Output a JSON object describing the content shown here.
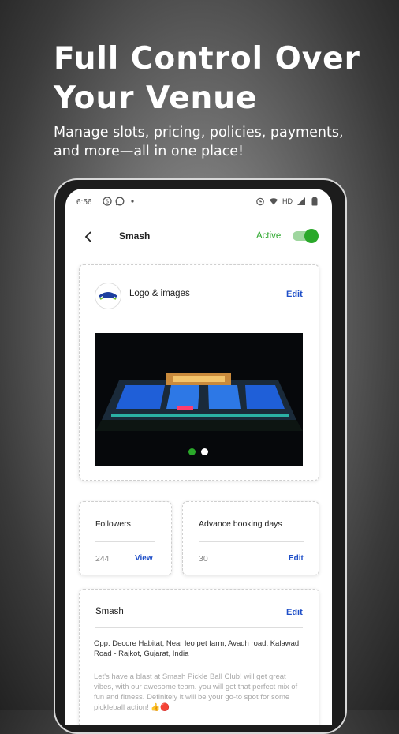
{
  "promo": {
    "headline_line1": "Full Control Over",
    "headline_line2": "Your Venue",
    "subline_line1": "Manage slots, pricing, policies, payments,",
    "subline_line2": "and more—all in one place!"
  },
  "statusbar": {
    "time": "6:56",
    "left_icons": [
      "skype-icon",
      "whatsapp-icon",
      "dot-icon"
    ],
    "right_text": "HD",
    "right_icons": [
      "alarm-icon",
      "wifi-icon",
      "signal-icon",
      "battery-icon"
    ]
  },
  "appbar": {
    "title": "Smash",
    "active_label": "Active",
    "active_toggle_on": true
  },
  "logo_card": {
    "label": "Logo & images",
    "edit_label": "Edit",
    "carousel_count": 2,
    "carousel_active_index": 0
  },
  "stats": {
    "followers_label": "Followers",
    "followers_value": "244",
    "followers_link": "View",
    "advance_label": "Advance booking days",
    "advance_value": "30",
    "advance_link": "Edit"
  },
  "venue_card": {
    "name": "Smash",
    "edit_label": "Edit",
    "address": "Opp. Decore Habitat, Near leo pet farm, Avadh road, Kalawad Road - Rajkot, Gujarat, India",
    "description": "Let's have a blast at Smash Pickle Ball Club! will get great vibes, with our awesome team. you will get that perfect mix of fun and fitness. Definitely it will be your go-to spot for some pickleball action! 👍🔴"
  },
  "colors": {
    "accent_green": "#2aa82a",
    "link_blue": "#1f4fc8"
  }
}
